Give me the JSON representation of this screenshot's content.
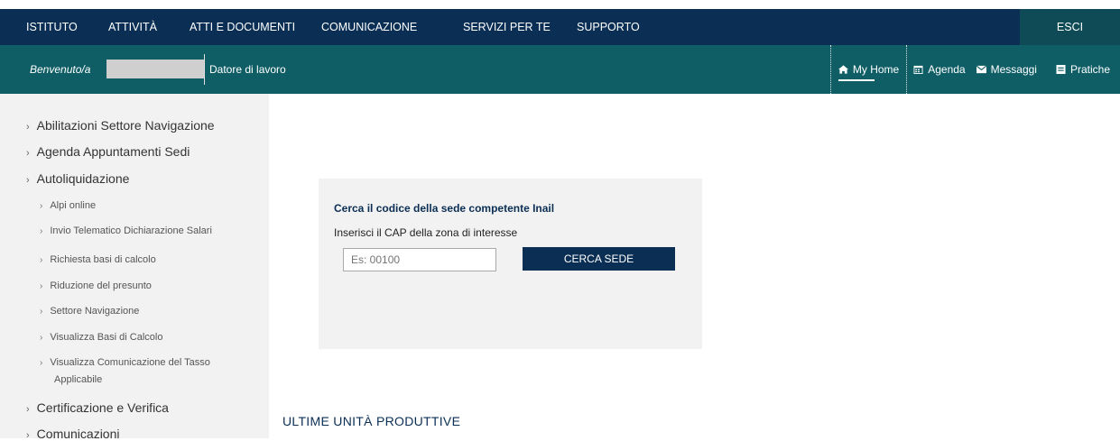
{
  "topnav": {
    "items": [
      "ISTITUTO",
      "ATTIVITÀ",
      "ATTI E DOCUMENTI",
      "COMUNICAZIONE",
      "SERVIZI PER TE",
      "SUPPORTO"
    ],
    "logout": "ESCI"
  },
  "subnav": {
    "welcome": "Benvenuto/a",
    "role": "Datore di lavoro",
    "links": [
      {
        "label": "My Home",
        "icon": "home-icon"
      },
      {
        "label": "Agenda",
        "icon": "calendar-icon"
      },
      {
        "label": "Messaggi",
        "icon": "envelope-icon"
      },
      {
        "label": "Pratiche",
        "icon": "folder-icon"
      }
    ]
  },
  "sidebar": {
    "top_items": [
      "Abilitazioni Settore Navigazione",
      "Agenda Appuntamenti Sedi",
      "Autoliquidazione"
    ],
    "sub_items": [
      "Alpi online",
      "Invio Telematico Dichiarazione Salari",
      "Richiesta basi di calcolo",
      "Riduzione del presunto",
      "Settore Navigazione",
      "Visualizza Basi di Calcolo",
      "Visualizza Comunicazione del Tasso",
      "Applicabile"
    ],
    "bottom_items": [
      "Certificazione e Verifica",
      "Comunicazioni"
    ]
  },
  "search": {
    "title": "Cerca il codice della sede competente Inail",
    "label": "Inserisci il CAP della zona di interesse",
    "placeholder": "Es: 00100",
    "button": "CERCA SEDE"
  },
  "section": {
    "title": "ULTIME UNITÀ PRODUTTIVE"
  },
  "colors": {
    "topnav_bg": "#0a2e54",
    "subnav_bg": "#0f5e66",
    "logout_bg": "#0e4b57"
  }
}
